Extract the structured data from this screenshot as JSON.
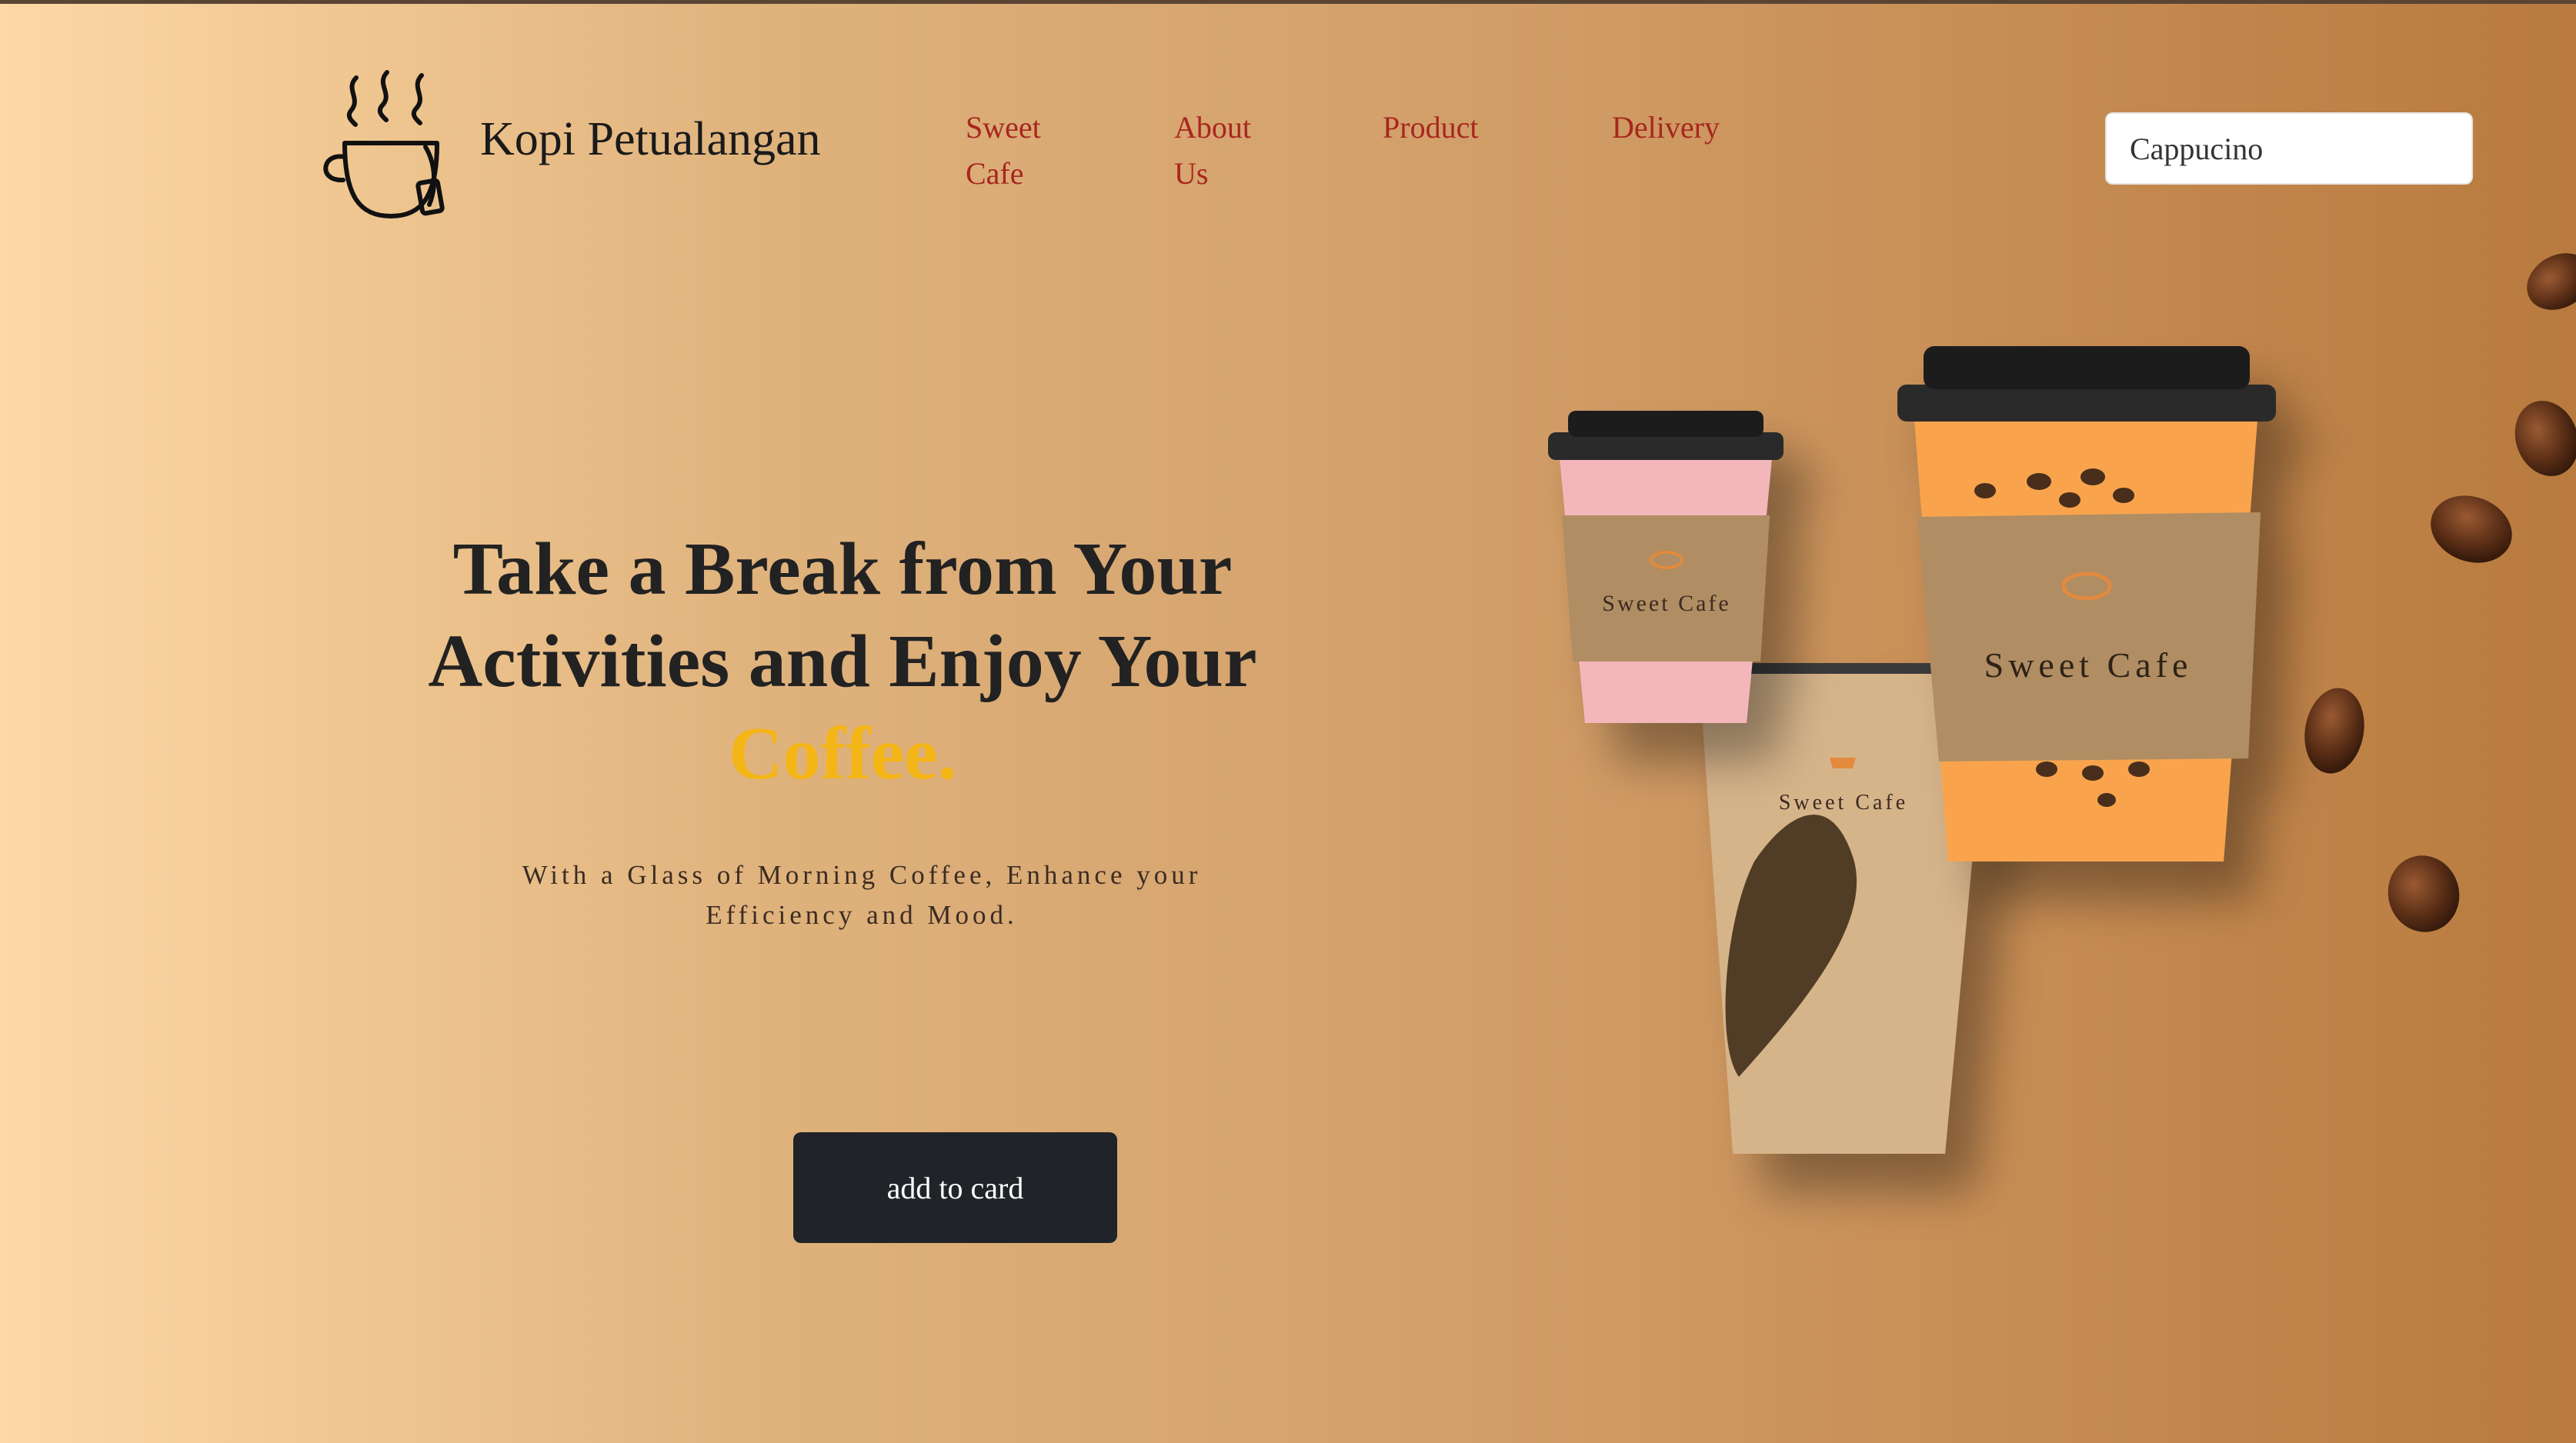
{
  "header": {
    "brand": "Kopi Petualangan",
    "nav": [
      {
        "label": "Sweet Cafe"
      },
      {
        "label": "About Us"
      },
      {
        "label": "Product"
      },
      {
        "label": "Delivery"
      }
    ],
    "search": {
      "value": "Cappucino"
    },
    "logo_icon": "coffee-cup-steam-icon"
  },
  "hero": {
    "headline_main": "Take a Break from Your Activities and Enjoy Your ",
    "headline_accent": "Coffee.",
    "subtitle": "With a Glass of Morning Coffee, Enhance your Efficiency and Mood.",
    "cta_label": "add to card"
  },
  "illustration": {
    "cup_brand": "Sweet Cafe"
  },
  "colors": {
    "nav_link": "#a8261f",
    "accent": "#f4b516",
    "button_bg": "#202428",
    "headline": "#222222"
  }
}
